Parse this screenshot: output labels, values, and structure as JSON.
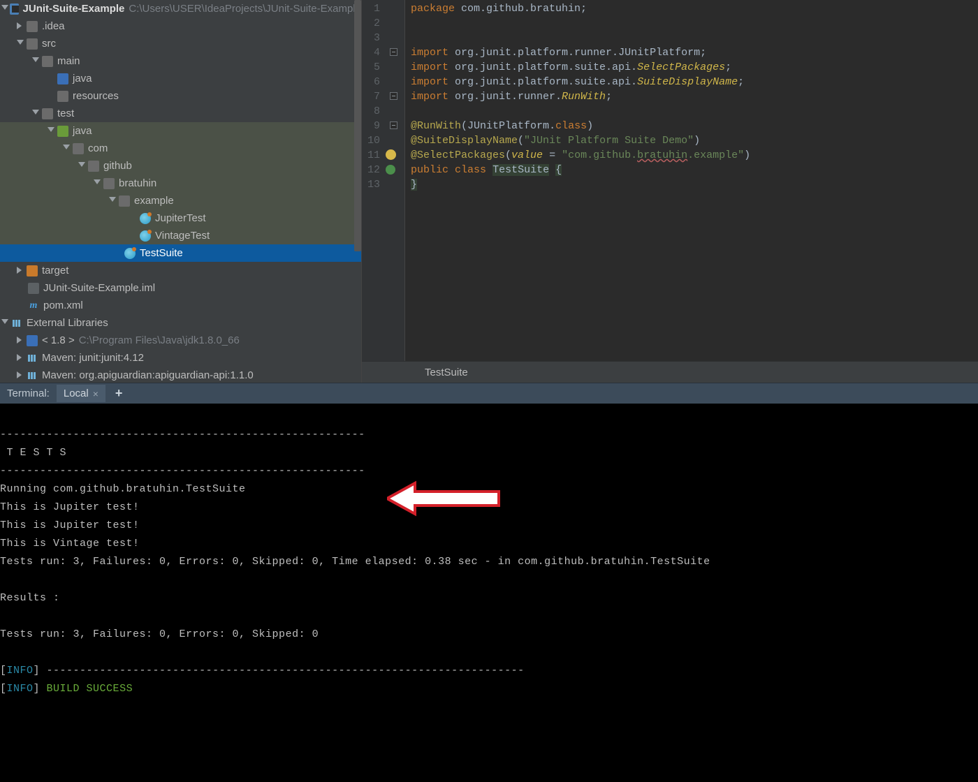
{
  "tree": {
    "project": {
      "name": "JUnit-Suite-Example",
      "path": "C:\\Users\\USER\\IdeaProjects\\JUnit-Suite-Example"
    },
    "idea": ".idea",
    "src": "src",
    "main": "main",
    "main_java": "java",
    "main_resources": "resources",
    "test": "test",
    "test_java": "java",
    "com": "com",
    "github": "github",
    "bratuhin": "bratuhin",
    "example": "example",
    "jupiterTest": "JupiterTest",
    "vintageTest": "VintageTest",
    "testSuite": "TestSuite",
    "target": "target",
    "iml": "JUnit-Suite-Example.iml",
    "pom": "pom.xml",
    "extLib": "External Libraries",
    "jdk": {
      "name": "< 1.8 >",
      "path": "C:\\Program Files\\Java\\jdk1.8.0_66"
    },
    "mvn_junit": "Maven: junit:junit:4.12",
    "mvn_apiguardian": "Maven: org.apiguardian:apiguardian-api:1.1.0"
  },
  "code": {
    "l1": {
      "kw": "package",
      "rest": " com.github.bratuhin;"
    },
    "l4": {
      "kw": "import",
      "rest1": " org.junit.platform.runner.",
      "cls": "JUnitPlatform",
      "semi": ";"
    },
    "l5": {
      "kw": "import",
      "rest1": " org.junit.platform.suite.api.",
      "cls": "SelectPackages",
      "semi": ";"
    },
    "l6": {
      "kw": "import",
      "rest1": " org.junit.platform.suite.api.",
      "cls": "SuiteDisplayName",
      "semi": ";"
    },
    "l7": {
      "kw": "import",
      "rest1": " org.junit.runner.",
      "cls": "RunWith",
      "semi": ";"
    },
    "l9": {
      "ann": "@RunWith",
      "open": "(",
      "cls": "JUnitPlatform",
      "dot": ".",
      "kw": "class",
      "close": ")"
    },
    "l10": {
      "ann": "@SuiteDisplayName",
      "open": "(",
      "str": "\"JUnit Platform Suite Demo\"",
      "close": ")"
    },
    "l11": {
      "ann": "@SelectPackages",
      "open": "(",
      "param": "value",
      "eq": " = ",
      "str1": "\"com.github.",
      "str_wavy": "bratuhin",
      "str2": ".example\"",
      "close": ")"
    },
    "l12": {
      "kw1": "public",
      "kw2": "class",
      "name": "TestSuite",
      "brace": "{"
    },
    "l13": {
      "brace": "}"
    }
  },
  "breadcrumb": "TestSuite",
  "terminal": {
    "label": "Terminal:",
    "tab": "Local",
    "lines": {
      "dash": "-------------------------------------------------------",
      "tests_header": " T E S T S",
      "running": "Running com.github.bratuhin.TestSuite",
      "jup1": "This is Jupiter test!",
      "jup2": "This is Jupiter test!",
      "vin": "This is Vintage test!",
      "summary1": "Tests run: 3, Failures: 0, Errors: 0, Skipped: 0, Time elapsed: 0.38 sec - in com.github.bratuhin.TestSuite",
      "results": "Results :",
      "summary2": "Tests run: 3, Failures: 0, Errors: 0, Skipped: 0",
      "info_dash": "] ------------------------------------------------------------------------",
      "build": "BUILD SUCCESS",
      "info": "INFO"
    }
  },
  "gutter_lines": [
    "1",
    "2",
    "3",
    "4",
    "5",
    "6",
    "7",
    "8",
    "9",
    "10",
    "11",
    "12",
    "13"
  ]
}
